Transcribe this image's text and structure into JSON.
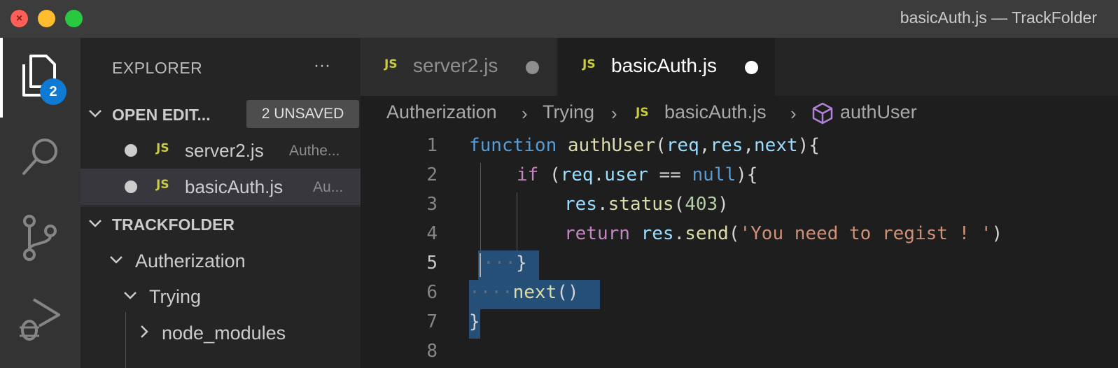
{
  "window": {
    "title": "basicAuth.js — TrackFolder"
  },
  "activity_bar": {
    "explorer_badge": "2",
    "items": [
      "files-icon",
      "search-icon",
      "source-control-icon",
      "run-debug-icon"
    ]
  },
  "sidebar": {
    "title": "EXPLORER",
    "more_actions": "···",
    "open_editors": {
      "label": "OPEN EDIT...",
      "unsaved": "2 UNSAVED",
      "files": [
        {
          "name": "server2.js",
          "desc": "Authe...",
          "icon": "JS"
        },
        {
          "name": "basicAuth.js",
          "desc": "Au...",
          "icon": "JS"
        }
      ]
    },
    "folder": {
      "label": "TRACKFOLDER",
      "tree": [
        {
          "name": "Autherization"
        },
        {
          "name": "Trying"
        },
        {
          "name": "node_modules"
        }
      ]
    }
  },
  "editor": {
    "tabs": [
      {
        "label": "server2.js",
        "icon": "JS",
        "active": false,
        "dirty": true
      },
      {
        "label": "basicAuth.js",
        "icon": "JS",
        "active": true,
        "dirty": true
      }
    ],
    "breadcrumb": [
      "Autherization",
      "Trying",
      "basicAuth.js",
      "authUser"
    ],
    "breadcrumb_icon": "JS",
    "line_numbers": [
      "1",
      "2",
      "3",
      "4",
      "5",
      "6",
      "7",
      "8"
    ],
    "current_line": 5,
    "code": {
      "l1": {
        "kw": "function",
        "fn": "authUser",
        "p1": "(",
        "a1": "req",
        "c1": ",",
        "a2": "res",
        "c2": ",",
        "a3": "next",
        "p2": "){"
      },
      "l2": {
        "kw": "if",
        "p1": " (",
        "v1": "req",
        "dot": ".",
        "v2": "user",
        "op": " == ",
        "nul": "null",
        "p2": "){"
      },
      "l3": {
        "v1": "res",
        "dot": ".",
        "fn": "status",
        "p1": "(",
        "num": "403",
        "p2": ")"
      },
      "l4": {
        "kw": "return",
        "v1": "res",
        "dot": ".",
        "fn": "send",
        "p1": "(",
        "str": "'You need to regist ! '",
        "p2": ")"
      },
      "l5": {
        "ws": "···",
        "brace": "}"
      },
      "l6": {
        "ws": "····",
        "fn": "next",
        "p": "()"
      },
      "l7": {
        "brace": "}"
      }
    }
  },
  "colors": {
    "accent": "#0e7ad3",
    "selection": "#264f78",
    "keyword": "#569cd6",
    "function": "#dcdcaa",
    "variable": "#9cdcfe",
    "control": "#c586c0",
    "number": "#b5cea8",
    "string": "#ce9178"
  }
}
